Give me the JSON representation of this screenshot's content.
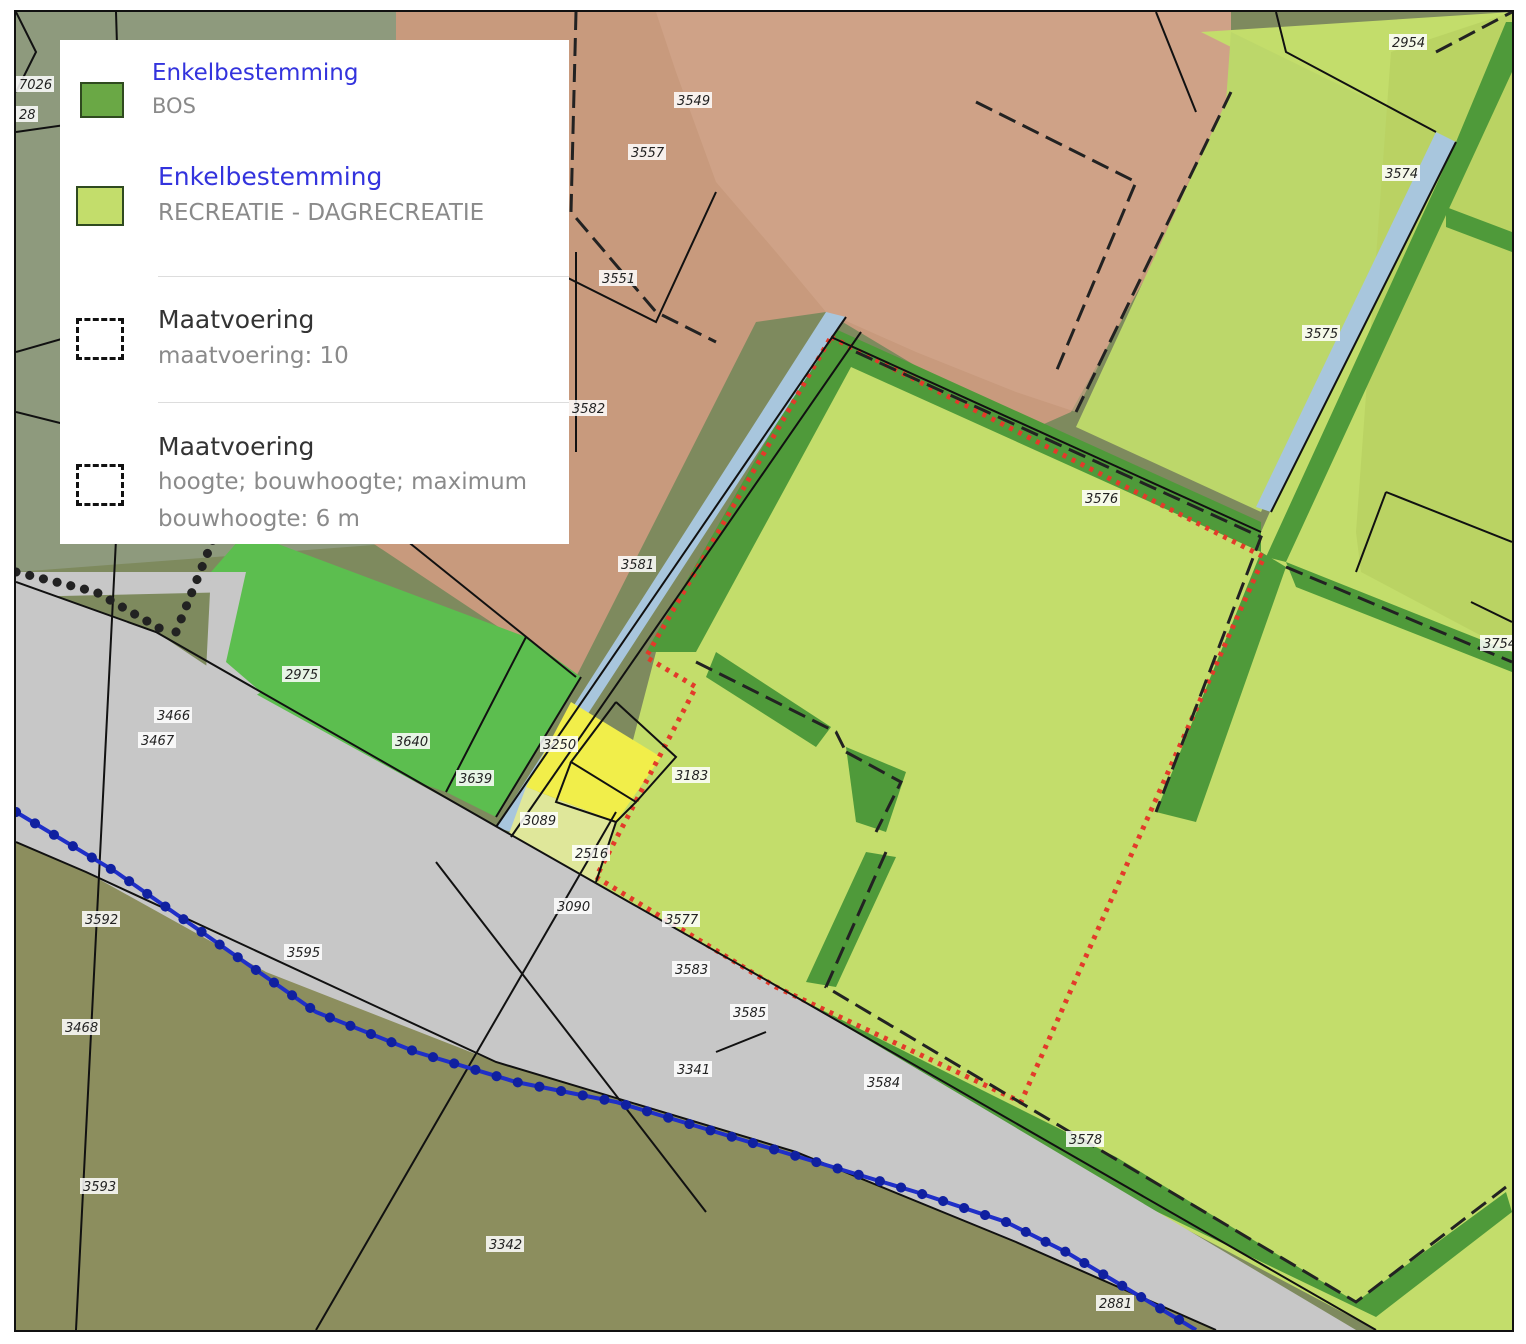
{
  "legend": {
    "items": [
      {
        "title": "Enkelbestemming",
        "subtitle": "BOS",
        "swatch_color": "#6aa845",
        "swatch_border": "#2f4a1f",
        "icon": "solid-swatch"
      },
      {
        "title": "Enkelbestemming",
        "subtitle": "RECREATIE - DAGRECREATIE",
        "swatch_color": "#c3dd6b",
        "swatch_border": "#2f4a1f",
        "icon": "solid-swatch"
      },
      {
        "title": "Maatvoering",
        "subtitle": "maatvoering: 10",
        "icon": "dashed-outline-swatch"
      },
      {
        "title": "Maatvoering",
        "subtitle": "hoogte; bouwhoogte; maximum",
        "subtitle2": "bouwhoogte: 6 m",
        "icon": "dashed-outline-swatch"
      }
    ]
  },
  "map": {
    "colors": {
      "bos": "#4f9a3a",
      "recreatie": "#c3dd6b",
      "maatschappelijk": "#c89a7d",
      "verkeer": "#c8c8c8",
      "groen": "#5cbe4f",
      "wonen": "#f1ee4a",
      "water": "#a8c6dd",
      "agrarisch": "#7d8a5c",
      "plan_boundary": "#e33a2a",
      "watergang": "#2020c0"
    },
    "parcel_labels": [
      "2954",
      "3549",
      "3557",
      "3574",
      "3551",
      "3575",
      "3582",
      "3576",
      "3581",
      "3754",
      "2975",
      "3466",
      "3467",
      "3640",
      "3639",
      "3250",
      "3183",
      "3089",
      "2516",
      "3090",
      "3577",
      "3592",
      "3595",
      "3583",
      "3585",
      "3468",
      "3341",
      "3584",
      "3578",
      "3593",
      "3342",
      "2881",
      "7026",
      "28"
    ]
  }
}
